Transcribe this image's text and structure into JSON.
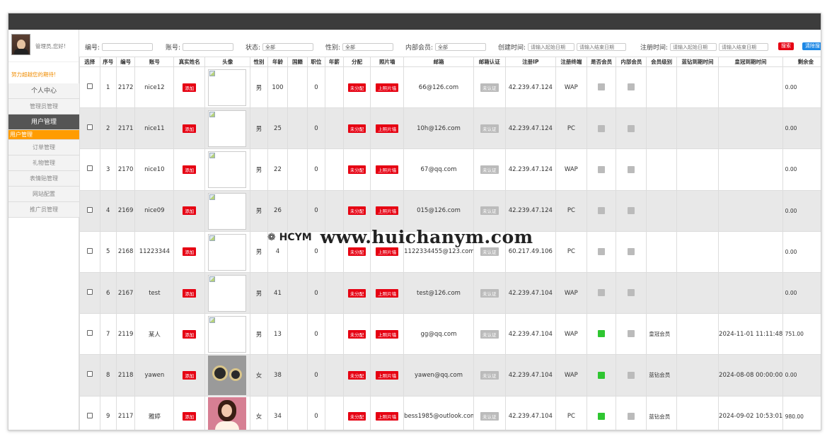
{
  "sidebar": {
    "greeting": "管理员,您好!",
    "motto": "努力超越您的期待!",
    "menu": [
      "个人中心",
      "管理员管理",
      "用户管理",
      "用户管理",
      "订单管理",
      "礼物管理",
      "表情贴管理",
      "网站配置",
      "推广员管理"
    ]
  },
  "filters": {
    "id_label": "编号:",
    "account_label": "账号:",
    "status_label": "状态:",
    "status_value": "全部",
    "gender_label": "性别:",
    "gender_value": "全部",
    "internal_label": "内部会员:",
    "internal_value": "全部",
    "created_label": "创建时间:",
    "start_placeholder": "请输入起始日期",
    "end_placeholder": "请输入结束日期",
    "registered_label": "注册时间:",
    "reg_start_placeholder": "请输入起始日期",
    "reg_end_placeholder": "请输入结束日期",
    "search_button": "搜索",
    "clear_button": "清除搜"
  },
  "table": {
    "headers": [
      "选择",
      "序号",
      "编号",
      "账号",
      "真实姓名",
      "头像",
      "性别",
      "年龄",
      "国籍",
      "职位",
      "年薪",
      "分配",
      "照片墙",
      "邮箱",
      "邮箱认证",
      "注册IP",
      "注册终端",
      "是否会员",
      "内部会员",
      "会员级别",
      "蓝钻到期时间",
      "皇冠到期时间",
      "剩余金"
    ],
    "badges": {
      "add": "添加",
      "unassigned": "未分配",
      "upload_photos": "上照片墙",
      "unverified": "未认证"
    },
    "rows": [
      {
        "seq": "1",
        "id": "2172",
        "account": "nice12",
        "avatar": "broken",
        "gender": "男",
        "age": "100",
        "salary": "0",
        "email": "66@126.com",
        "ip": "42.239.47.124",
        "terminal": "WAP",
        "member": false,
        "level": "",
        "blue_exp": "",
        "crown_exp": "",
        "balance": "0.00"
      },
      {
        "seq": "2",
        "id": "2171",
        "account": "nice11",
        "avatar": "broken",
        "gender": "男",
        "age": "25",
        "salary": "0",
        "email": "10h@126.com",
        "ip": "42.239.47.124",
        "terminal": "PC",
        "member": false,
        "level": "",
        "blue_exp": "",
        "crown_exp": "",
        "balance": "0.00"
      },
      {
        "seq": "3",
        "id": "2170",
        "account": "nice10",
        "avatar": "broken",
        "gender": "男",
        "age": "22",
        "salary": "0",
        "email": "67@qq.com",
        "ip": "42.239.47.124",
        "terminal": "WAP",
        "member": false,
        "level": "",
        "blue_exp": "",
        "crown_exp": "",
        "balance": "0.00"
      },
      {
        "seq": "4",
        "id": "2169",
        "account": "nice09",
        "avatar": "broken",
        "gender": "男",
        "age": "26",
        "salary": "0",
        "email": "015@126.com",
        "ip": "42.239.47.124",
        "terminal": "PC",
        "member": false,
        "level": "",
        "blue_exp": "",
        "crown_exp": "",
        "balance": "0.00"
      },
      {
        "seq": "5",
        "id": "2168",
        "account": "11223344",
        "avatar": "broken",
        "gender": "男",
        "age": "4",
        "salary": "0",
        "email": "1122334455@123.com",
        "ip": "60.217.49.106",
        "terminal": "PC",
        "member": false,
        "level": "",
        "blue_exp": "",
        "crown_exp": "",
        "balance": "0.00"
      },
      {
        "seq": "6",
        "id": "2167",
        "account": "test",
        "avatar": "broken",
        "gender": "男",
        "age": "41",
        "salary": "0",
        "email": "test@126.com",
        "ip": "42.239.47.104",
        "terminal": "WAP",
        "member": false,
        "level": "",
        "blue_exp": "",
        "crown_exp": "",
        "balance": "0.00"
      },
      {
        "seq": "7",
        "id": "2119",
        "account": "某人",
        "avatar": "broken",
        "gender": "男",
        "age": "13",
        "salary": "0",
        "email": "gg@qq.com",
        "ip": "42.239.47.104",
        "terminal": "WAP",
        "member": true,
        "level": "皇冠会员",
        "blue_exp": "",
        "crown_exp": "2024-11-01 11:11:48",
        "balance": "751.00"
      },
      {
        "seq": "8",
        "id": "2118",
        "account": "yawen",
        "avatar": "watch",
        "gender": "女",
        "age": "38",
        "salary": "0",
        "email": "yawen@qq.com",
        "ip": "42.239.47.104",
        "terminal": "WAP",
        "member": true,
        "level": "蓝钻会员",
        "blue_exp": "",
        "crown_exp": "2024-08-08 00:00:00",
        "balance": "0.00"
      },
      {
        "seq": "9",
        "id": "2117",
        "account": "雅婷",
        "avatar": "girl",
        "gender": "女",
        "age": "34",
        "salary": "0",
        "email": "bess1985@outlook.com",
        "ip": "42.239.47.104",
        "terminal": "PC",
        "member": true,
        "level": "蓝钻会员",
        "blue_exp": "",
        "crown_exp": "2024-09-02 10:53:01",
        "balance": "980.00"
      }
    ]
  },
  "watermark": {
    "logo": "HCYM",
    "url": "www.huichanym.com"
  },
  "colors": {
    "topbar": "#3c3c3c",
    "accent": "#ff9c00",
    "badge_red": "#e60012",
    "member_green": "#2fc631"
  }
}
